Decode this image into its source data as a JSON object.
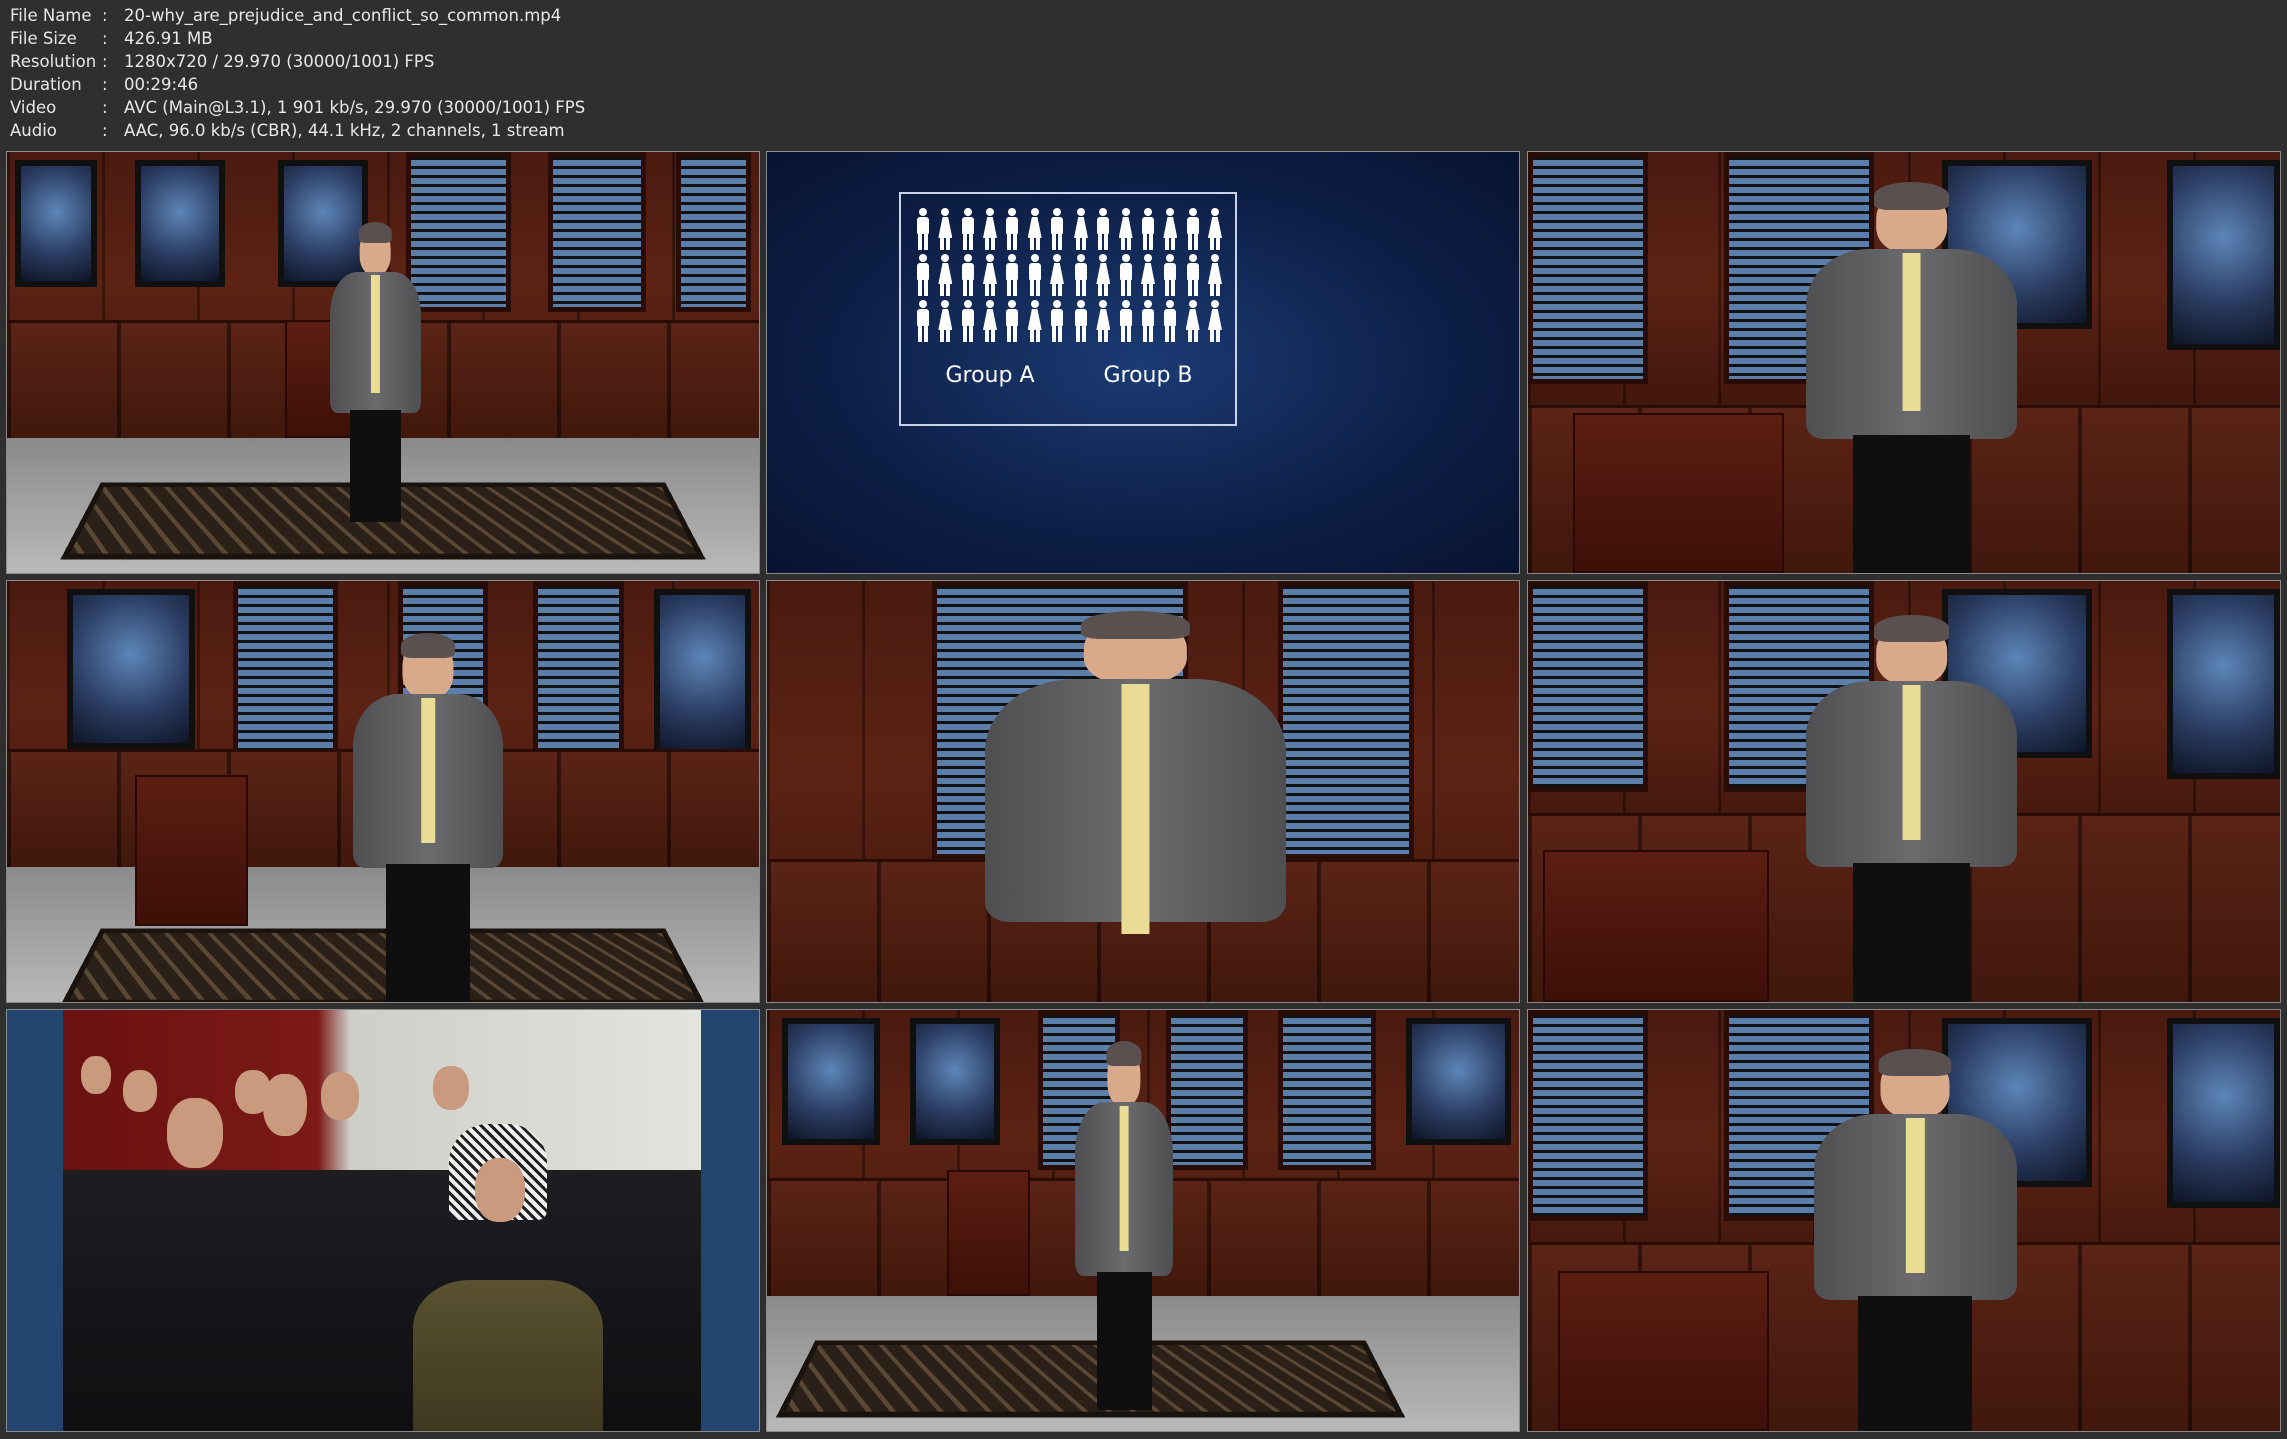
{
  "info": [
    {
      "label": "File Name",
      "sep": ":",
      "value": "20-why_are_prejudice_and_conflict_so_common.mp4"
    },
    {
      "label": "File Size",
      "sep": ":",
      "value": "426.91 MB"
    },
    {
      "label": "Resolution",
      "sep": ":",
      "value": "1280x720 / 29.970 (30000/1001) FPS"
    },
    {
      "label": "Duration",
      "sep": ":",
      "value": "00:29:46"
    },
    {
      "label": "Video",
      "sep": ":",
      "value": "AVC (Main@L3.1), 1 901 kb/s, 29.970 (30000/1001) FPS"
    },
    {
      "label": "Audio",
      "sep": ":",
      "value": "AAC, 96.0 kb/s (CBR), 44.1 kHz, 2 channels, 1 stream"
    }
  ],
  "slide": {
    "group_a": "Group A",
    "group_b": "Group B"
  },
  "colors": {
    "background": "#2f2f2f",
    "text": "#e8e8e8",
    "slide_blue": "#0d1e45",
    "tie_yellow": "#e9dc95"
  },
  "thumbnails": [
    {
      "scene": "studio-wide"
    },
    {
      "scene": "slide-groups"
    },
    {
      "scene": "studio-medium"
    },
    {
      "scene": "studio-medium-podium"
    },
    {
      "scene": "studio-closeup"
    },
    {
      "scene": "studio-medium"
    },
    {
      "scene": "news-photo"
    },
    {
      "scene": "studio-wide"
    },
    {
      "scene": "studio-medium"
    }
  ]
}
